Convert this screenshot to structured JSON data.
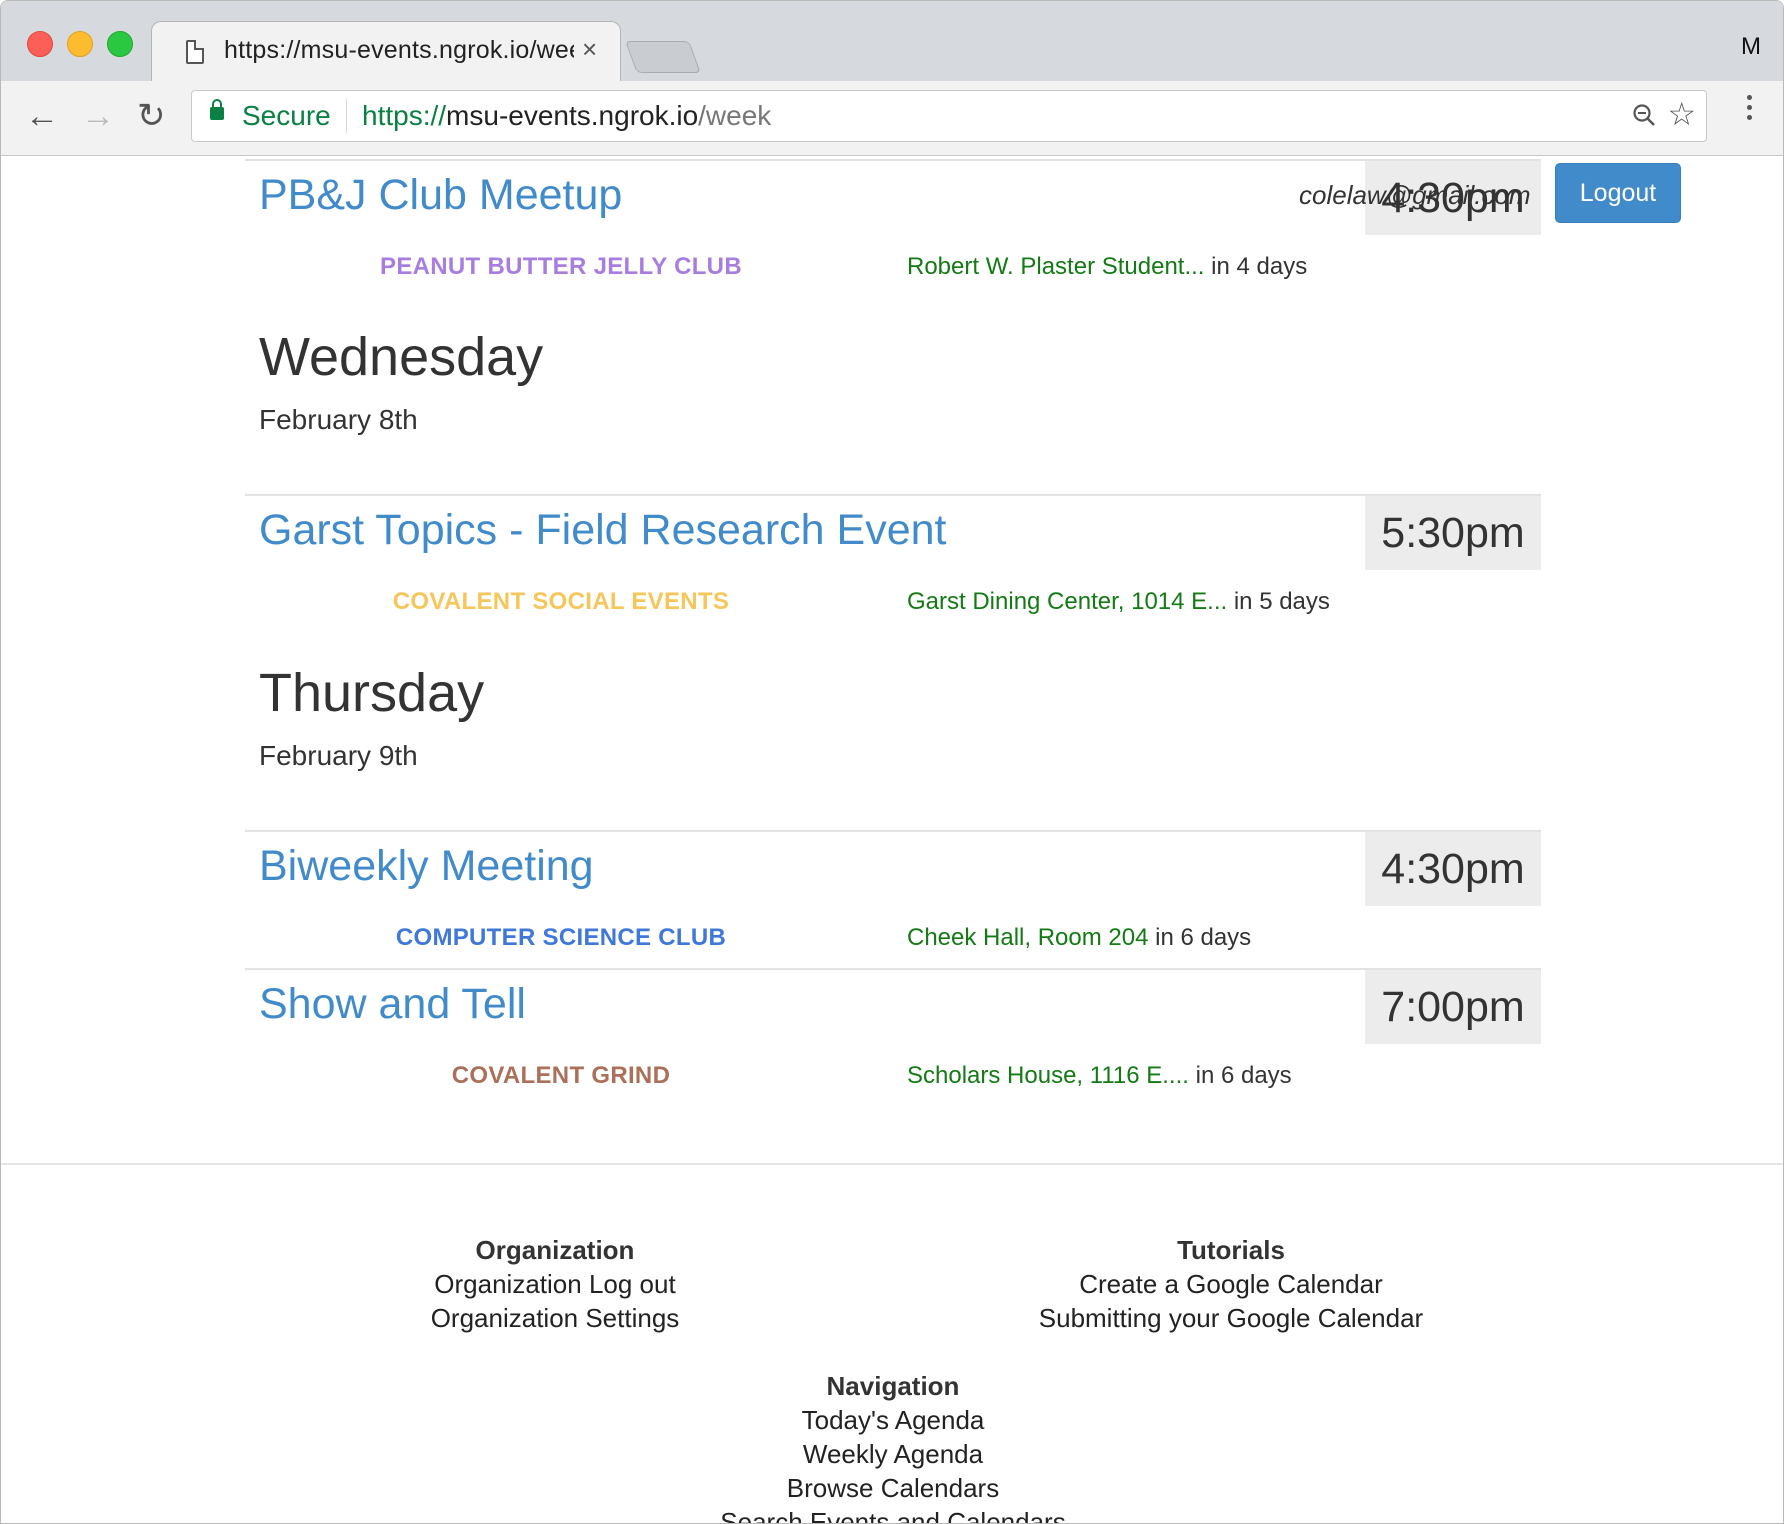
{
  "browser": {
    "tab_title": "https://msu-events.ngrok.io/week",
    "tab_close": "×",
    "profile_initial": "M",
    "secure_label": "Secure",
    "url_scheme": "https://",
    "url_host": "msu-events.ngrok.io",
    "url_path": "/week"
  },
  "header": {
    "user_email": "colelaw@gmail.com",
    "logout_label": "Logout",
    "logout_color": "#428bca"
  },
  "days": [
    {
      "events": [
        {
          "title": "PB&J Club Meetup",
          "time": "4:30pm",
          "org": "PEANUT BUTTER JELLY CLUB",
          "org_color": "#a77ee0",
          "location": "Robert W. Plaster Student...",
          "relative": " in 4 days"
        }
      ]
    },
    {
      "heading": "Wednesday",
      "date": "February 8th",
      "events": [
        {
          "title": "Garst Topics - Field Research Event",
          "time": "5:30pm",
          "org": "COVALENT SOCIAL EVENTS",
          "org_color": "#f6c65a",
          "location": "Garst Dining Center, 1014 E...",
          "relative": " in 5 days"
        }
      ]
    },
    {
      "heading": "Thursday",
      "date": "February 9th",
      "events": [
        {
          "title": "Biweekly Meeting",
          "time": "4:30pm",
          "org": "COMPUTER SCIENCE CLUB",
          "org_color": "#3f78d8",
          "location": "Cheek Hall, Room 204",
          "relative": " in 6 days"
        },
        {
          "title": "Show and Tell",
          "time": "7:00pm",
          "org": "COVALENT GRIND",
          "org_color": "#ab7059",
          "location": "Scholars House, 1116 E....",
          "relative": " in 6 days"
        }
      ]
    }
  ],
  "footer": {
    "organization": {
      "heading": "Organization",
      "links": [
        "Organization Log out",
        "Organization Settings"
      ]
    },
    "tutorials": {
      "heading": "Tutorials",
      "links": [
        "Create a Google Calendar",
        "Submitting your Google Calendar"
      ]
    },
    "navigation": {
      "heading": "Navigation",
      "links": [
        "Today's Agenda",
        "Weekly Agenda",
        "Browse Calendars",
        "Search Events and Calendars"
      ]
    }
  },
  "colors": {
    "link": "#428bca",
    "location": "#137a14",
    "secure": "#0b8043"
  }
}
